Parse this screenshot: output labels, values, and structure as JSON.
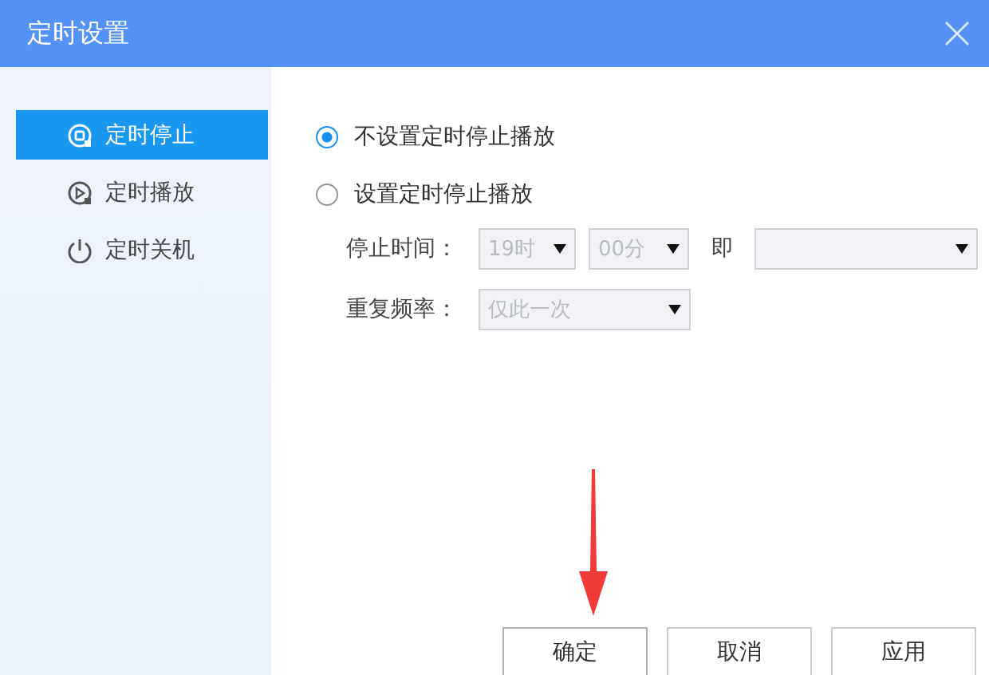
{
  "window": {
    "title": "定时设置"
  },
  "sidebar": {
    "items": [
      {
        "label": "定时停止",
        "kind": "stop",
        "selected": true
      },
      {
        "label": "定时播放",
        "kind": "play",
        "selected": false
      },
      {
        "label": "定时关机",
        "kind": "power",
        "selected": false
      }
    ]
  },
  "options": [
    {
      "label": "不设置定时停止播放",
      "selected": true
    },
    {
      "label": "设置定时停止播放",
      "selected": false
    }
  ],
  "stop_time": {
    "label": "停止时间：",
    "hour": {
      "value": "19时",
      "disabled": true
    },
    "minute": {
      "value": "00分",
      "disabled": true
    },
    "separator": "即",
    "date": {
      "disabled": true
    }
  },
  "repeat": {
    "label": "重复频率：",
    "value": "仅此一次",
    "disabled": true
  },
  "buttons": [
    "确定",
    "取消",
    "应用"
  ]
}
